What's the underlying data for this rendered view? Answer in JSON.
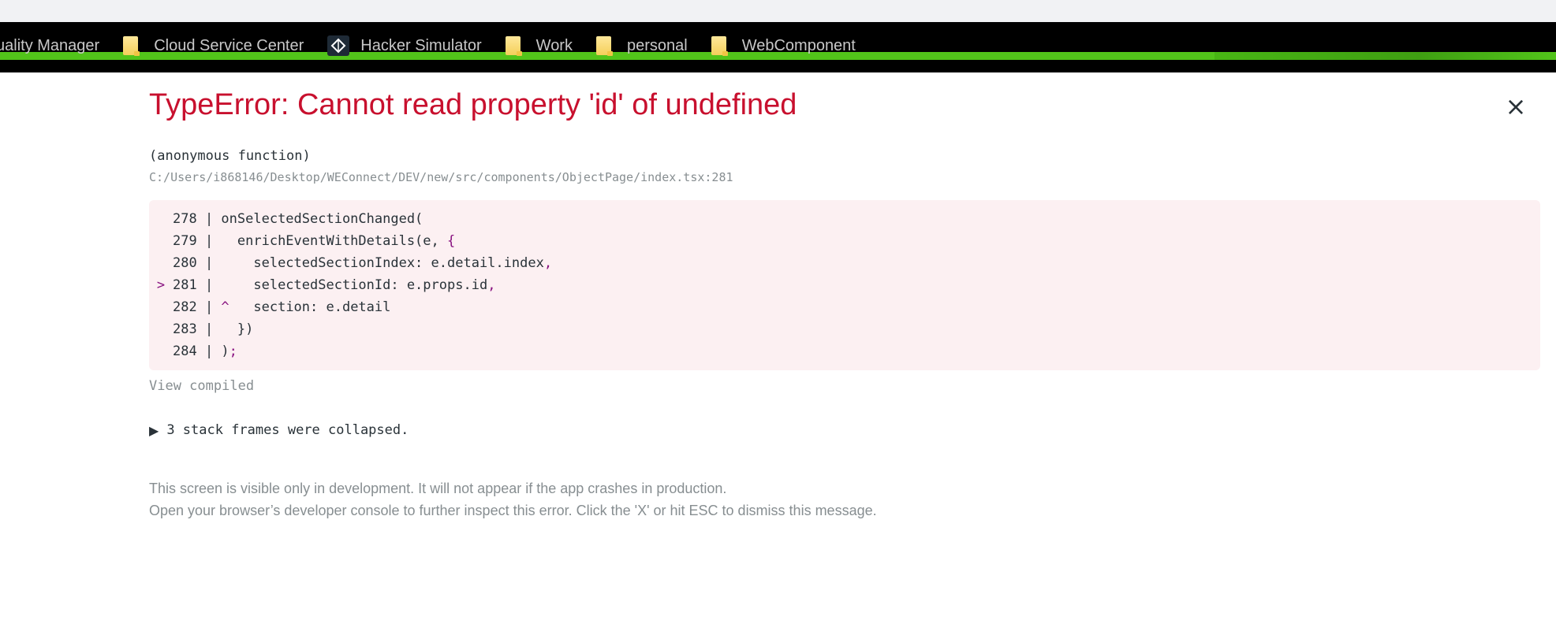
{
  "bookmarks": [
    {
      "icon": "folder-icon",
      "label": "uality Manager"
    },
    {
      "icon": "folder-icon",
      "label": "Cloud Service Center"
    },
    {
      "icon": "unity-icon",
      "label": "Hacker Simulator"
    },
    {
      "icon": "folder-icon",
      "label": "Work"
    },
    {
      "icon": "folder-icon",
      "label": "personal"
    },
    {
      "icon": "folder-icon",
      "label": "WebComponent"
    }
  ],
  "error": {
    "title": "TypeError: Cannot read property 'id' of undefined",
    "close_label": "×",
    "function_name": "(anonymous function)",
    "file_path": "C:/Users/i868146/Desktop/WEConnect/DEV/new/src/components/ObjectPage/index.tsx:281",
    "code_lines": [
      {
        "marker": "",
        "num": "278",
        "code": "onSelectedSectionChanged("
      },
      {
        "marker": "",
        "num": "279",
        "code": "  enrichEventWithDetails(e, {"
      },
      {
        "marker": "",
        "num": "280",
        "code": "    selectedSectionIndex: e.detail.index,"
      },
      {
        "marker": ">",
        "num": "281",
        "code": "    selectedSectionId: e.props.id,"
      },
      {
        "marker": "",
        "num": "282",
        "code": "^   section: e.detail"
      },
      {
        "marker": "",
        "num": "283",
        "code": "  })"
      },
      {
        "marker": "",
        "num": "284",
        "code": ");"
      }
    ],
    "view_compiled": "View compiled",
    "collapsed_frames": "3 stack frames were collapsed.",
    "note_line1": "This screen is visible only in development. It will not appear if the app crashes in production.",
    "note_line2": "Open your browser’s developer console to further inspect this error.  Click the 'X' or hit ESC to dismiss this message."
  },
  "colors": {
    "error_red": "#c8102e",
    "code_bg": "#fcf0f2",
    "muted_gray": "#878e91",
    "accent_green": "#52c41a"
  }
}
